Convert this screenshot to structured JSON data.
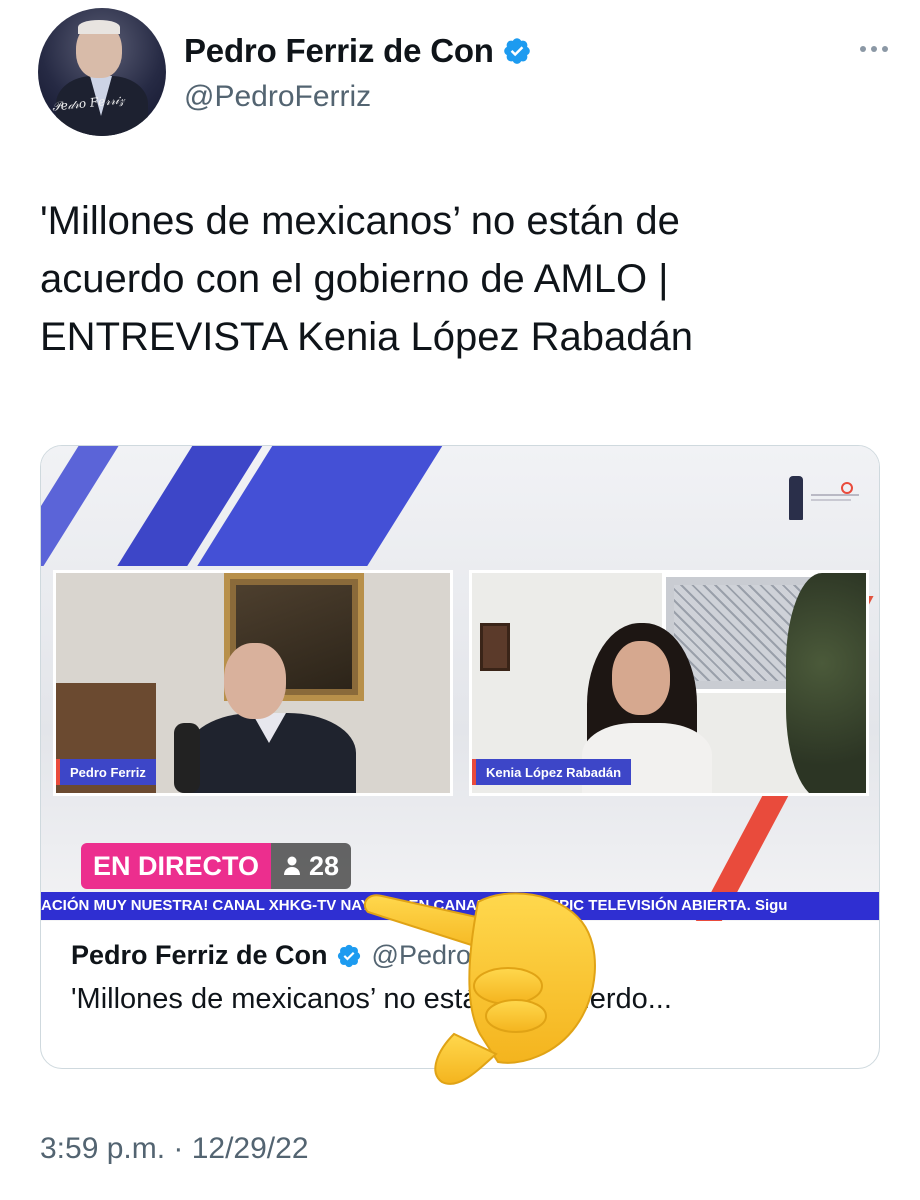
{
  "author": {
    "name": "Pedro Ferriz de Con",
    "handle": "@PedroFerriz",
    "avatar_signature": "Pedro Ferriz de Con"
  },
  "tweet": {
    "text": "'Millones de mexicanos’ no están de\nacuerdo con el gobierno de AMLO |\nENTREVISTA Kenia López Rabadán",
    "timestamp": "3:59 p.m. · 12/29/22"
  },
  "card": {
    "video": {
      "left_guest_label": "Pedro Ferriz",
      "right_guest_label": "Kenia López Rabadán",
      "live_label": "EN DIRECTO",
      "viewer_count": "28",
      "ticker_text": "ACIÓN MUY NUESTRA! CANAL XHKG-TV NAYARIT EN CANAL 4.1 DE TEPIC TELEVISIÓN ABIERTA. Sigu"
    },
    "author_name": "Pedro Ferriz de Con",
    "author_handle": "@PedroFerriz",
    "title": "'Millones de mexicanos’ no están de acuerdo..."
  },
  "icons": {
    "verified": "verified-badge-icon",
    "more": "more-options-icon",
    "viewers": "person-icon",
    "overlay": "backhand-index-pointing-left-emoji"
  },
  "colors": {
    "verified": "#1d9bf0",
    "live": "#ec2e8e",
    "ticker": "#2f2fd2",
    "stripe": "#3d46c8",
    "secondary_text": "#536471"
  }
}
